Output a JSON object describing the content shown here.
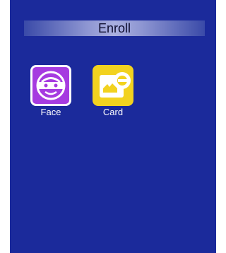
{
  "screen": {
    "title": "Enroll",
    "colors": {
      "background": "#1b2a9b",
      "face_tile": "#a63be0",
      "card_tile": "#f2d21f"
    }
  },
  "tiles": [
    {
      "label": "Face",
      "icon": "face-icon"
    },
    {
      "label": "Card",
      "icon": "card-icon"
    }
  ]
}
